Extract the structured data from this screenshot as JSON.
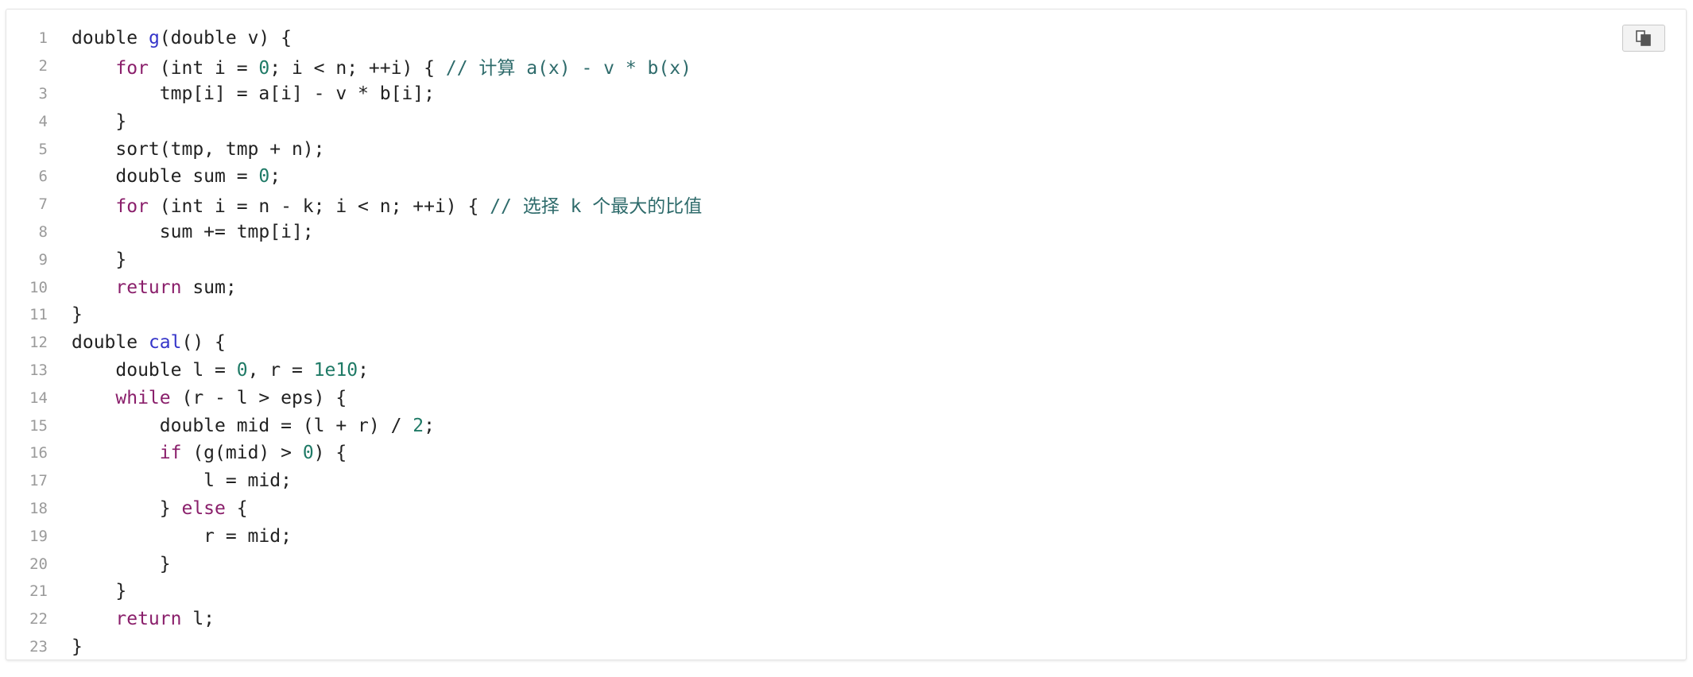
{
  "code_block": {
    "copy_button": {
      "icon": "copy-icon"
    },
    "colors": {
      "keyword": "#8a1f6b",
      "function": "#3535c9",
      "number": "#1f7a66",
      "comment": "#2e6b6b",
      "text": "#222222",
      "line_number": "#9a9a9a"
    },
    "lines": [
      {
        "num": "1",
        "tokens": [
          {
            "t": "text",
            "v": "double "
          },
          {
            "t": "fn",
            "v": "g"
          },
          {
            "t": "text",
            "v": "(double v) {"
          }
        ]
      },
      {
        "num": "2",
        "tokens": [
          {
            "t": "text",
            "v": "    "
          },
          {
            "t": "kw",
            "v": "for"
          },
          {
            "t": "text",
            "v": " (int i = "
          },
          {
            "t": "num",
            "v": "0"
          },
          {
            "t": "text",
            "v": "; i < n; ++i) { "
          },
          {
            "t": "cm",
            "v": "// 计算 a(x) - v * b(x)"
          }
        ]
      },
      {
        "num": "3",
        "tokens": [
          {
            "t": "text",
            "v": "        tmp[i] = a[i] - v * b[i];"
          }
        ]
      },
      {
        "num": "4",
        "tokens": [
          {
            "t": "text",
            "v": "    }"
          }
        ]
      },
      {
        "num": "5",
        "tokens": [
          {
            "t": "text",
            "v": "    sort(tmp, tmp + n);"
          }
        ]
      },
      {
        "num": "6",
        "tokens": [
          {
            "t": "text",
            "v": "    double sum = "
          },
          {
            "t": "num",
            "v": "0"
          },
          {
            "t": "text",
            "v": ";"
          }
        ]
      },
      {
        "num": "7",
        "tokens": [
          {
            "t": "text",
            "v": "    "
          },
          {
            "t": "kw",
            "v": "for"
          },
          {
            "t": "text",
            "v": " (int i = n - k; i < n; ++i) { "
          },
          {
            "t": "cm",
            "v": "// 选择 k 个最大的比值"
          }
        ]
      },
      {
        "num": "8",
        "tokens": [
          {
            "t": "text",
            "v": "        sum += tmp[i];"
          }
        ]
      },
      {
        "num": "9",
        "tokens": [
          {
            "t": "text",
            "v": "    }"
          }
        ]
      },
      {
        "num": "10",
        "tokens": [
          {
            "t": "text",
            "v": "    "
          },
          {
            "t": "kw",
            "v": "return"
          },
          {
            "t": "text",
            "v": " sum;"
          }
        ]
      },
      {
        "num": "11",
        "tokens": [
          {
            "t": "text",
            "v": "}"
          }
        ]
      },
      {
        "num": "12",
        "tokens": [
          {
            "t": "text",
            "v": "double "
          },
          {
            "t": "fn",
            "v": "cal"
          },
          {
            "t": "text",
            "v": "() {"
          }
        ]
      },
      {
        "num": "13",
        "tokens": [
          {
            "t": "text",
            "v": "    double l = "
          },
          {
            "t": "num",
            "v": "0"
          },
          {
            "t": "text",
            "v": ", r = "
          },
          {
            "t": "num",
            "v": "1e10"
          },
          {
            "t": "text",
            "v": ";"
          }
        ]
      },
      {
        "num": "14",
        "tokens": [
          {
            "t": "text",
            "v": "    "
          },
          {
            "t": "kw",
            "v": "while"
          },
          {
            "t": "text",
            "v": " (r - l > eps) {"
          }
        ]
      },
      {
        "num": "15",
        "tokens": [
          {
            "t": "text",
            "v": "        double mid = (l + r) / "
          },
          {
            "t": "num",
            "v": "2"
          },
          {
            "t": "text",
            "v": ";"
          }
        ]
      },
      {
        "num": "16",
        "tokens": [
          {
            "t": "text",
            "v": "        "
          },
          {
            "t": "kw",
            "v": "if"
          },
          {
            "t": "text",
            "v": " (g(mid) > "
          },
          {
            "t": "num",
            "v": "0"
          },
          {
            "t": "text",
            "v": ") {"
          }
        ]
      },
      {
        "num": "17",
        "tokens": [
          {
            "t": "text",
            "v": "            l = mid;"
          }
        ]
      },
      {
        "num": "18",
        "tokens": [
          {
            "t": "text",
            "v": "        } "
          },
          {
            "t": "kw",
            "v": "else"
          },
          {
            "t": "text",
            "v": " {"
          }
        ]
      },
      {
        "num": "19",
        "tokens": [
          {
            "t": "text",
            "v": "            r = mid;"
          }
        ]
      },
      {
        "num": "20",
        "tokens": [
          {
            "t": "text",
            "v": "        }"
          }
        ]
      },
      {
        "num": "21",
        "tokens": [
          {
            "t": "text",
            "v": "    }"
          }
        ]
      },
      {
        "num": "22",
        "tokens": [
          {
            "t": "text",
            "v": "    "
          },
          {
            "t": "kw",
            "v": "return"
          },
          {
            "t": "text",
            "v": " l;"
          }
        ]
      },
      {
        "num": "23",
        "tokens": [
          {
            "t": "text",
            "v": "}"
          }
        ]
      }
    ]
  }
}
